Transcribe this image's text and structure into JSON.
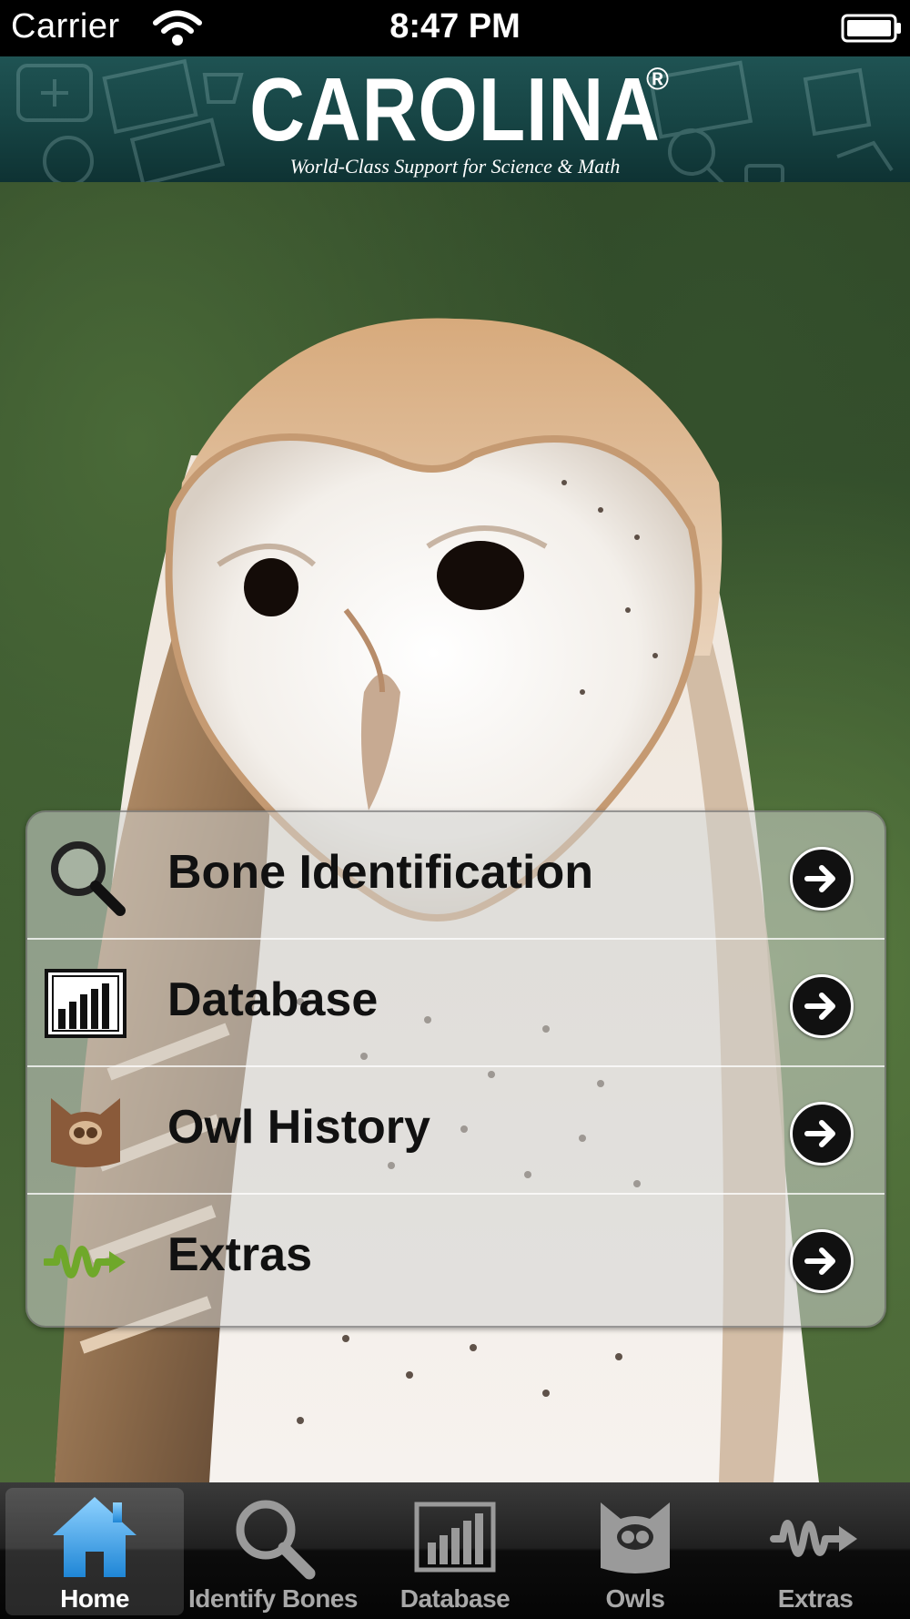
{
  "status_bar": {
    "carrier": "Carrier",
    "time": "8:47 PM"
  },
  "header": {
    "brand": "CAROLINA",
    "registered": "®",
    "tagline": "World-Class Support for Science & Math",
    "color": "#164343"
  },
  "menu": {
    "items": [
      {
        "label": "Bone Identification",
        "icon": "magnifier-icon"
      },
      {
        "label": "Database",
        "icon": "bar-chart-icon"
      },
      {
        "label": "Owl History",
        "icon": "owl-icon"
      },
      {
        "label": "Extras",
        "icon": "squiggle-arrow-icon"
      }
    ]
  },
  "tab_bar": {
    "tabs": [
      {
        "label": "Home",
        "icon": "home-icon",
        "active": true
      },
      {
        "label": "Identify Bones",
        "icon": "magnifier-icon",
        "active": false
      },
      {
        "label": "Database",
        "icon": "bar-chart-icon",
        "active": false
      },
      {
        "label": "Owls",
        "icon": "owl-icon",
        "active": false
      },
      {
        "label": "Extras",
        "icon": "squiggle-arrow-icon",
        "active": false
      }
    ]
  },
  "colors": {
    "accent_home": "#3aa7e8",
    "extras_green": "#6fa82a",
    "owl_brown": "#8a5a3a"
  }
}
